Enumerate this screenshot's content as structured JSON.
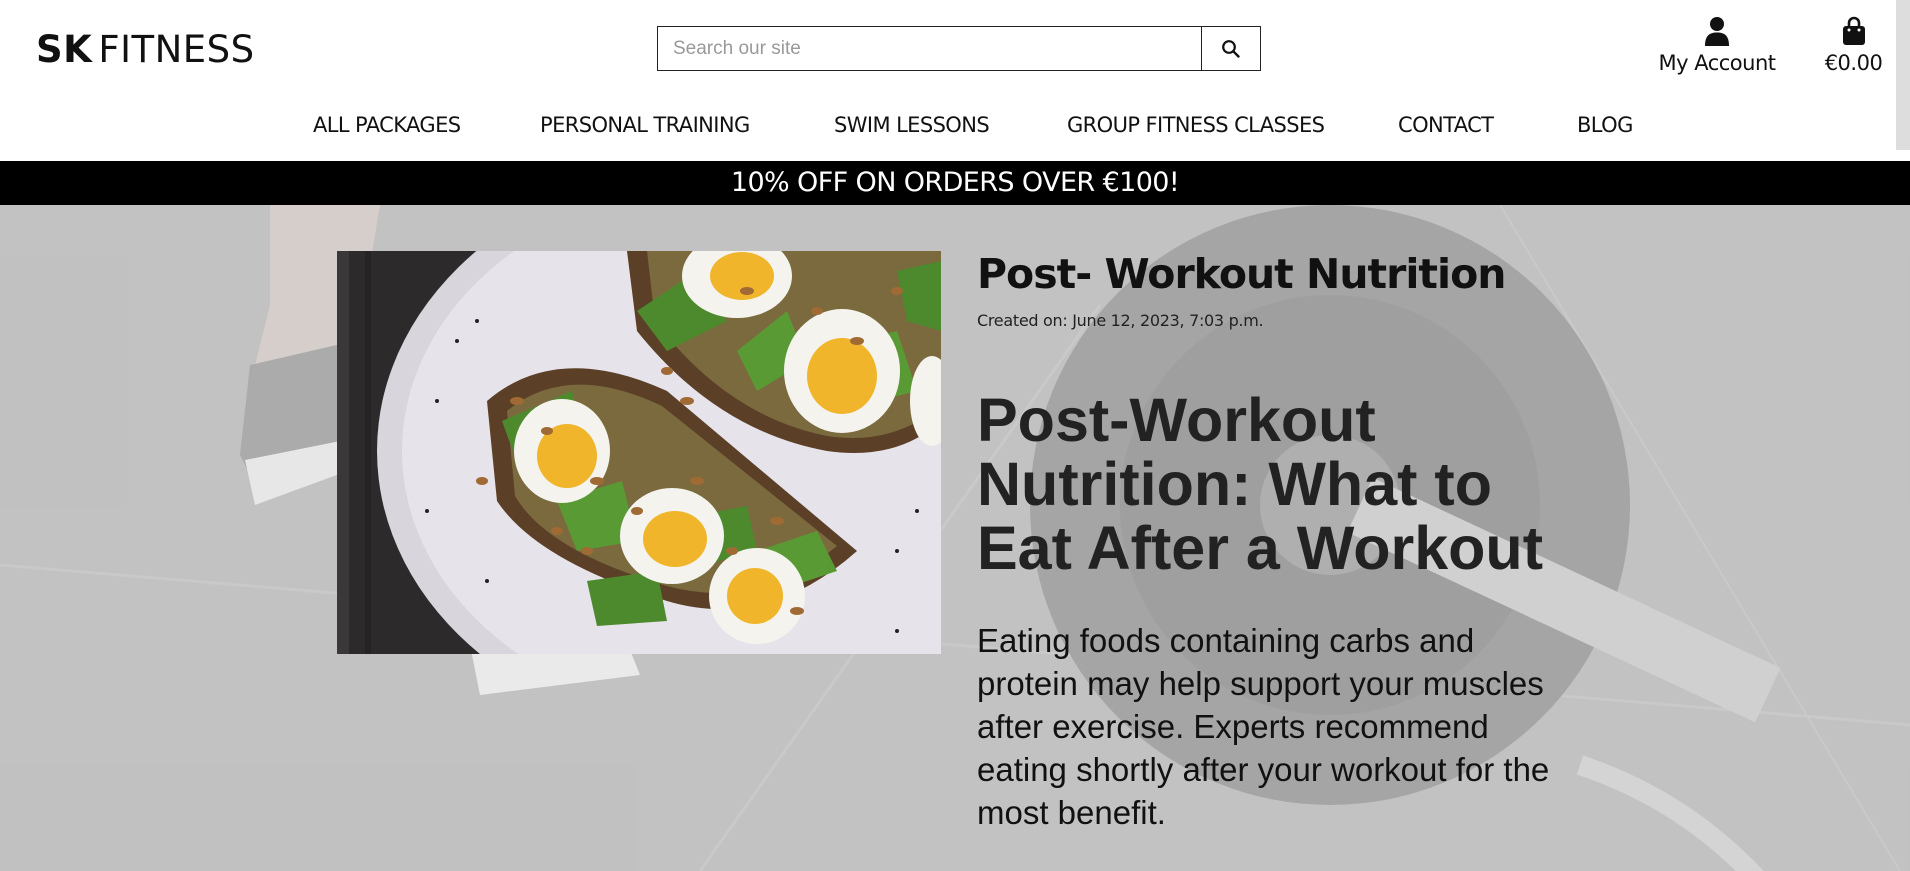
{
  "header": {
    "logo_bold": "SK",
    "logo_rest": "FITNESS",
    "search_placeholder": "Search our site",
    "account_label": "My Account",
    "cart_total": "€0.00"
  },
  "nav": {
    "items": [
      "ALL PACKAGES",
      "PERSONAL TRAINING",
      "SWIM LESSONS",
      "GROUP FITNESS CLASSES",
      "CONTACT",
      "BLOG"
    ]
  },
  "promo": {
    "text": "10% OFF ON ORDERS OVER €100!"
  },
  "post": {
    "title": "Post- Workout Nutrition",
    "created": "Created on: June 12, 2023, 7:03 p.m.",
    "heading": "Post-Workout Nutrition: What to Eat After a Workout",
    "body": "Eating foods containing carbs and protein may help support your muscles after exercise. Experts recommend eating shortly after your workout for the most benefit."
  }
}
